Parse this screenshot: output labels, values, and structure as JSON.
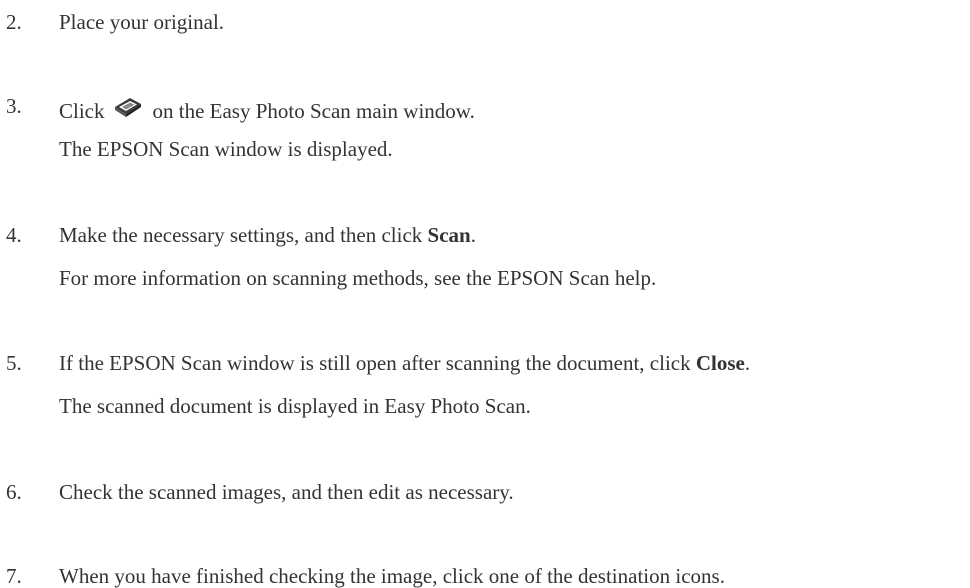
{
  "steps": [
    {
      "number": "2.",
      "text": "Place your original."
    },
    {
      "number": "3.",
      "text_before": "Click",
      "icon": "scanner-icon",
      "text_after": "on the Easy Photo Scan main window.",
      "sub": "The EPSON Scan window is displayed."
    },
    {
      "number": "4.",
      "text_before": "Make the necessary settings, and then click ",
      "bold": "Scan",
      "text_after": ".",
      "sub": "For more information on scanning methods, see the EPSON Scan help."
    },
    {
      "number": "5.",
      "text_before": "If the EPSON Scan window is still open after scanning the document, click ",
      "bold": "Close",
      "text_after": ".",
      "sub": "The scanned document is displayed in Easy Photo Scan."
    },
    {
      "number": "6.",
      "text": "Check the scanned images, and then edit as necessary."
    },
    {
      "number": "7.",
      "text": "When you have finished checking the image, click one of the destination icons."
    }
  ]
}
